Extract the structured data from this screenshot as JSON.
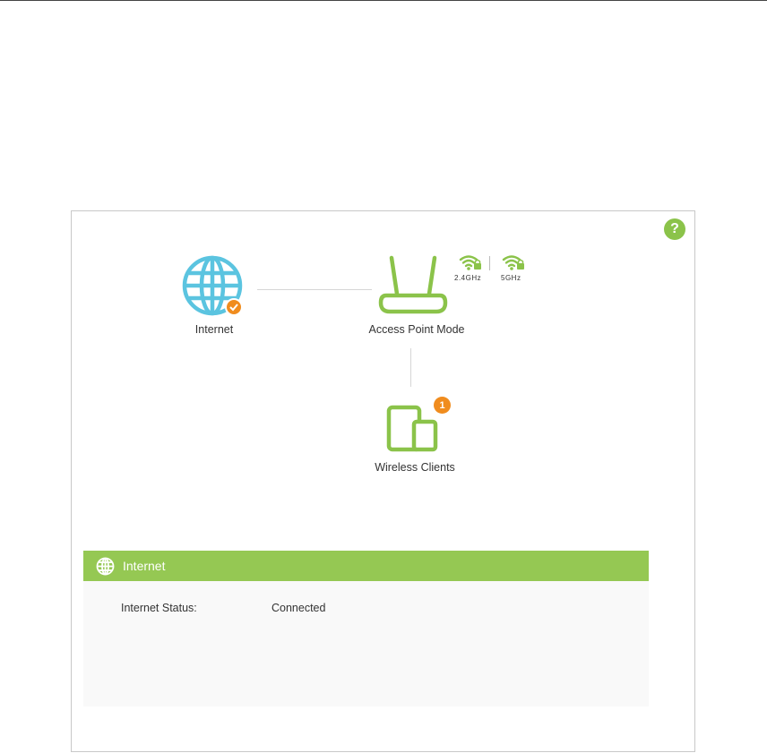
{
  "help": {
    "label": "?"
  },
  "topology": {
    "internet": {
      "label": "Internet",
      "status_color": "#f08c1e"
    },
    "router": {
      "label": "Access Point Mode",
      "band_24": "2.4GHz",
      "band_5": "5GHz"
    },
    "clients": {
      "label": "Wireless Clients",
      "count": "1"
    }
  },
  "section": {
    "title": "Internet",
    "rows": [
      {
        "label": "Internet Status:",
        "value": "Connected"
      }
    ]
  },
  "colors": {
    "accent_green": "#8bc34a",
    "header_green": "#95c853",
    "globe_blue": "#5bc4e0",
    "badge_orange": "#f08c1e"
  }
}
